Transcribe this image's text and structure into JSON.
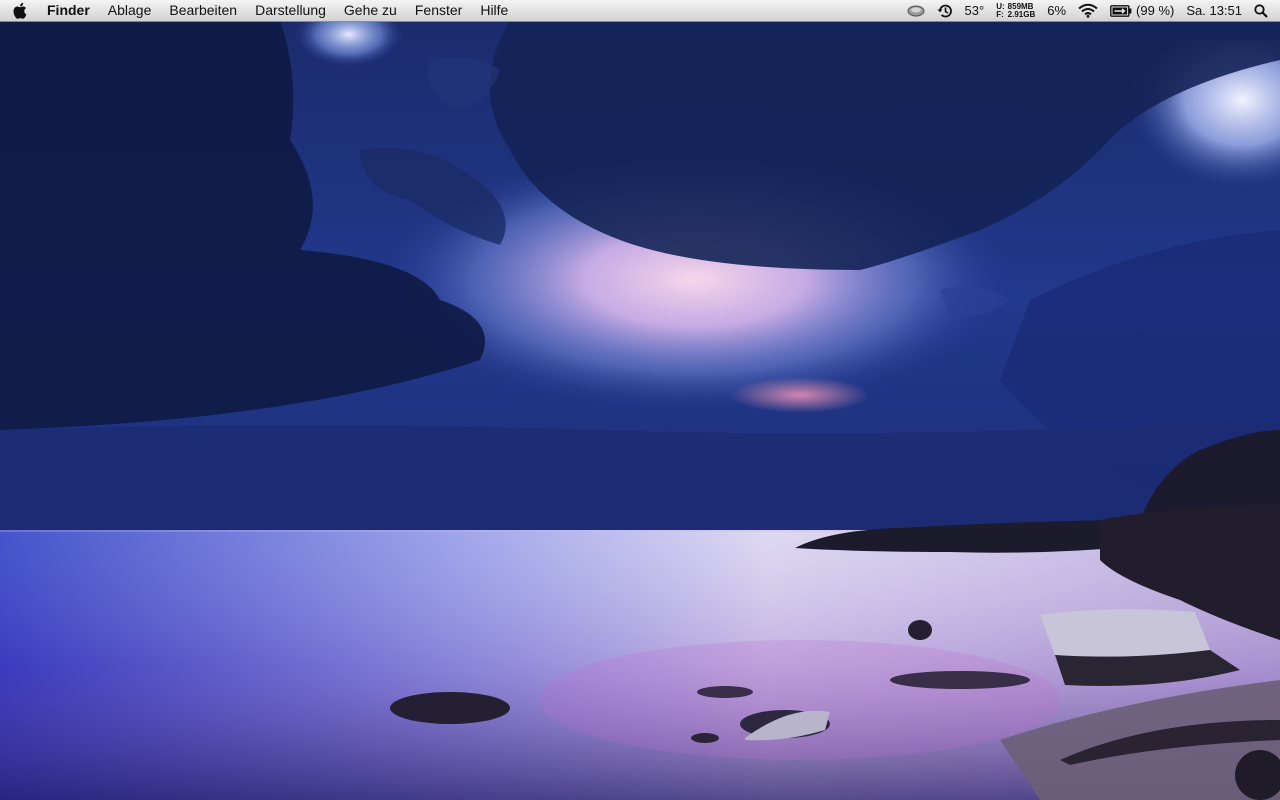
{
  "menubar": {
    "apple_icon": "apple-logo-icon",
    "app_name": "Finder",
    "menus": [
      "Ablage",
      "Bearbeiten",
      "Darstellung",
      "Gehe zu",
      "Fenster",
      "Hilfe"
    ]
  },
  "status": {
    "temperature": "53°",
    "memory_used_label": "U:",
    "memory_used": "859MB",
    "memory_free_label": "F:",
    "memory_free": "2.91GB",
    "cpu": "6%",
    "battery_percent": "(99 %)",
    "clock": "Sa. 13:51"
  },
  "colors": {
    "menubar_top": "#f4f4f4",
    "menubar_bottom": "#d2d2d2",
    "sky_dark": "#101a3f",
    "sky_blue": "#2a46a8",
    "horizon_pink": "#f3b6d8",
    "sea_light": "#dcd6f2",
    "sea_purple": "#6a3fa0"
  }
}
